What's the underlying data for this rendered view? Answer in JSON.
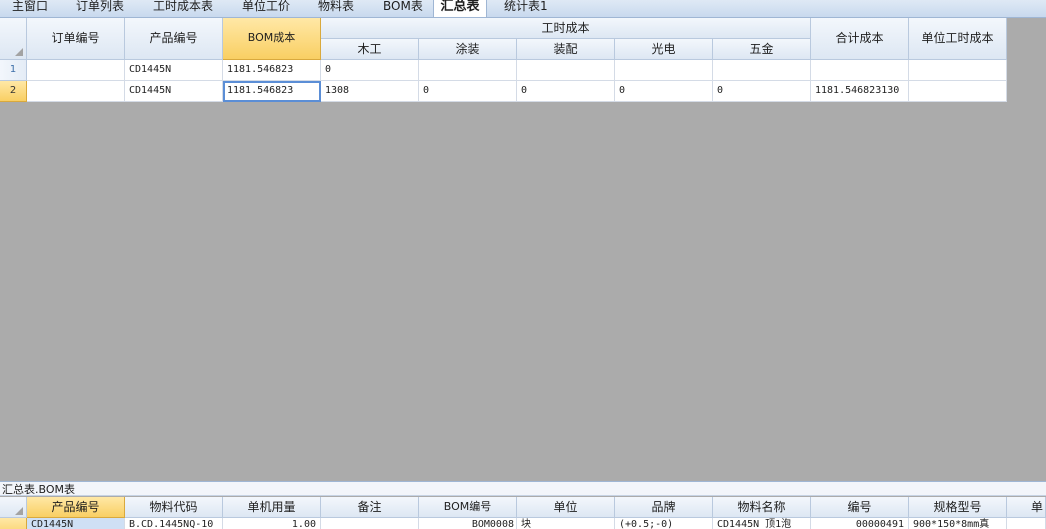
{
  "tabs": [
    {
      "label": "主窗口"
    },
    {
      "label": "订单列表"
    },
    {
      "label": "工时成本表"
    },
    {
      "label": "单位工价"
    },
    {
      "label": "物料表"
    },
    {
      "label": "BOM表"
    },
    {
      "label": "汇总表"
    },
    {
      "label": "统计表1"
    }
  ],
  "summary_table": {
    "headers": {
      "order_no": "订单编号",
      "product_no": "产品编号",
      "bom_cost": "BOM成本",
      "labor_cost": "工时成本",
      "wood": "木工",
      "paint": "涂装",
      "assembly": "装配",
      "optoelectronic": "光电",
      "hardware": "五金",
      "total_cost": "合计成本",
      "unit_labor_cost": "单位工时成本"
    },
    "rows": [
      {
        "row_no": "1",
        "order_no": "",
        "product_no": "CD1445N",
        "bom_cost": "1181.546823",
        "wood": "0",
        "paint": "",
        "assembly": "",
        "optoelectronic": "",
        "hardware": "",
        "total_cost": "",
        "unit_labor_cost": ""
      },
      {
        "row_no": "2",
        "order_no": "",
        "product_no": "CD1445N",
        "bom_cost": "1181.546823",
        "wood": "1308",
        "paint": "0",
        "assembly": "0",
        "optoelectronic": "0",
        "hardware": "0",
        "total_cost": "1181.546823130",
        "unit_labor_cost": ""
      }
    ]
  },
  "bom_panel": {
    "title": "汇总表.BOM表",
    "headers": {
      "product_no": "产品编号",
      "material_code": "物料代码",
      "unit_usage": "单机用量",
      "remark": "备注",
      "bom_no": "BOM编号",
      "unit": "单位",
      "brand": "品牌",
      "material_name": "物料名称",
      "number": "编号",
      "spec": "规格型号",
      "more": "单"
    },
    "rows": [
      {
        "product_no": "CD1445N",
        "material_code": "B.CD.1445NQ-10",
        "unit_usage": "1.00",
        "remark": "",
        "bom_no": "BOM0008",
        "unit": "块",
        "brand": "(+0.5;-0)",
        "material_name": "CD1445N 顶1泡",
        "number": "00000491",
        "spec": "900*150*8mm真"
      }
    ]
  }
}
